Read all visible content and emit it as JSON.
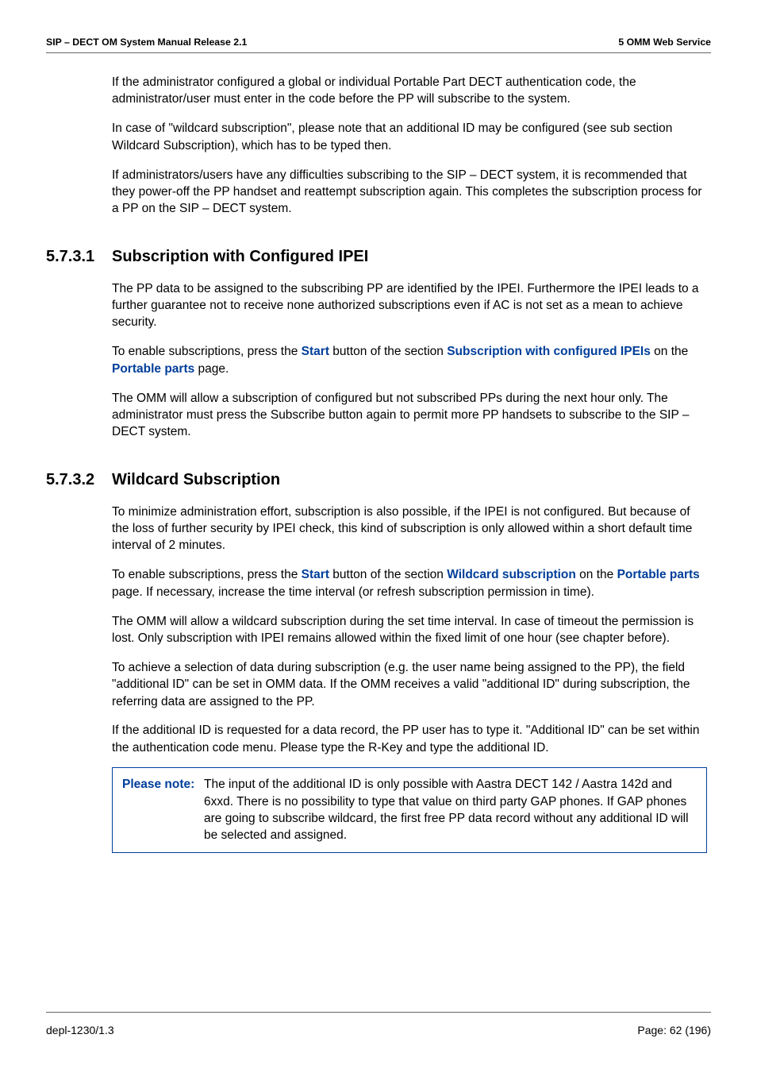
{
  "header": {
    "left": "SIP – DECT OM System Manual Release 2.1",
    "right": "5 OMM Web Service"
  },
  "intro": {
    "p1": "If the administrator configured a global or individual Portable Part DECT authentication code, the administrator/user must enter in the code before the PP will subscribe to the system.",
    "p2": "In case of \"wildcard subscription\", please note that an additional ID may be configured (see sub section Wildcard Subscription), which has to be typed then.",
    "p3": "If administrators/users have any difficulties subscribing to the SIP – DECT system, it is recommended that they power-off the PP handset and reattempt subscription again. This completes the subscription process for a PP on the SIP – DECT system."
  },
  "s1": {
    "number": "5.7.3.1",
    "title": "Subscription with Configured IPEI",
    "p1": "The PP data to be assigned to the subscribing PP are identified by the IPEI. Furthermore the IPEI leads to a further guarantee not to receive none authorized subscriptions even if AC is not set as a mean to achieve security.",
    "p2_pre": "To enable subscriptions, press the ",
    "p2_link1": "Start",
    "p2_mid1": " button of the section ",
    "p2_link2": "Subscription with configured IPEIs",
    "p2_mid2": " on the ",
    "p2_link3": "Portable parts",
    "p2_post": " page.",
    "p3": "The OMM will allow a subscription of configured but not subscribed PPs during the next hour only. The administrator must press the Subscribe button again to permit more PP handsets to subscribe to the SIP – DECT system."
  },
  "s2": {
    "number": "5.7.3.2",
    "title": "Wildcard Subscription",
    "p1": "To minimize administration effort, subscription is also possible, if the IPEI is not configured. But because of the loss of further security by IPEI check, this kind of subscription is only allowed within a short default time interval of 2 minutes.",
    "p2_pre": "To enable subscriptions, press the ",
    "p2_link1": "Start",
    "p2_mid1": " button of the section ",
    "p2_link2": "Wildcard subscription",
    "p2_mid2": " on the ",
    "p2_link3": "Portable parts",
    "p2_post": " page. If necessary, increase the time interval (or refresh subscription permission in time).",
    "p3": "The OMM will allow a wildcard subscription during the set time interval. In case of timeout the permission is lost. Only subscription with IPEI remains allowed within the fixed limit of one hour (see chapter before).",
    "p4": "To achieve a selection of data during subscription (e.g. the user name being assigned to the PP), the field \"additional ID\" can be set in OMM data. If the OMM receives a valid \"additional ID\" during subscription, the referring data are assigned to the PP.",
    "p5": "If the additional ID is requested for a data record, the PP user has to type it. \"Additional ID\" can be set within the authentication code menu. Please type the R-Key and type the additional ID.",
    "note_label": "Please note:",
    "note_body": "The input of the additional ID is only possible with Aastra DECT 142 / Aastra 142d and 6xxd. There is no possibility to type that value on third party GAP phones. If GAP phones are going to subscribe wildcard, the first free PP data record without any additional ID will be selected and assigned."
  },
  "footer": {
    "left": "depl-1230/1.3",
    "right": "Page: 62 (196)"
  }
}
